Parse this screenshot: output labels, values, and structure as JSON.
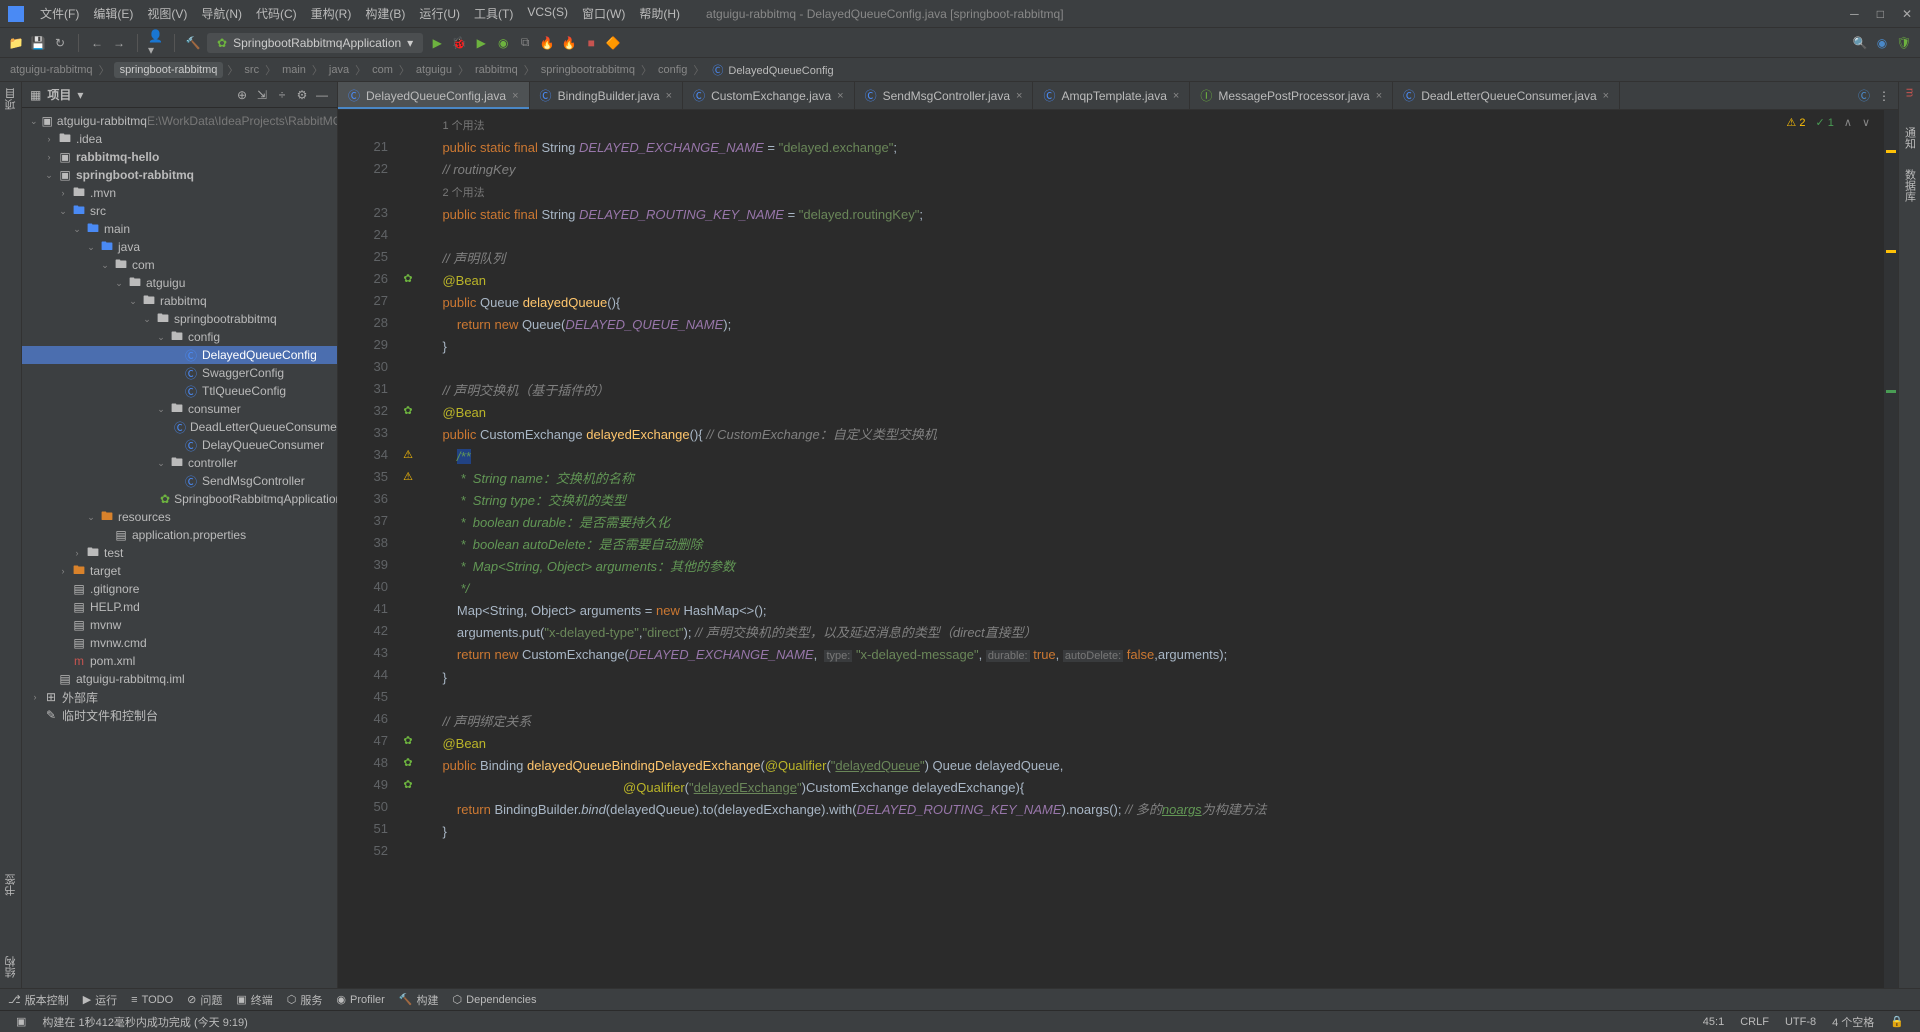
{
  "window": {
    "title": "atguigu-rabbitmq - DelayedQueueConfig.java [springboot-rabbitmq]"
  },
  "menu": {
    "file": "文件(F)",
    "edit": "编辑(E)",
    "view": "视图(V)",
    "navigate": "导航(N)",
    "code": "代码(C)",
    "refactor": "重构(R)",
    "build": "构建(B)",
    "run": "运行(U)",
    "tools": "工具(T)",
    "vcs": "VCS(S)",
    "window": "窗口(W)",
    "help": "帮助(H)"
  },
  "run_config": "SpringbootRabbitmqApplication",
  "breadcrumb": [
    "atguigu-rabbitmq",
    "springboot-rabbitmq",
    "src",
    "main",
    "java",
    "com",
    "atguigu",
    "rabbitmq",
    "springbootrabbitmq",
    "config",
    "DelayedQueueConfig"
  ],
  "project": {
    "title": "项目",
    "root": "atguigu-rabbitmq",
    "root_path": "E:\\WorkData\\IdeaProjects\\RabbitMQ\\at",
    "tree": [
      {
        "d": 0,
        "exp": true,
        "icon": "project",
        "label": "atguigu-rabbitmq",
        "suffix": "  E:\\WorkData\\IdeaProjects\\RabbitMQ\\at"
      },
      {
        "d": 1,
        "exp": false,
        "icon": "folder",
        "label": ".idea"
      },
      {
        "d": 1,
        "exp": false,
        "icon": "module",
        "label": "rabbitmq-hello",
        "bold": true
      },
      {
        "d": 1,
        "exp": true,
        "icon": "module",
        "label": "springboot-rabbitmq",
        "bold": true
      },
      {
        "d": 2,
        "exp": false,
        "icon": "folder",
        "label": ".mvn"
      },
      {
        "d": 2,
        "exp": true,
        "icon": "folder-blue",
        "label": "src"
      },
      {
        "d": 3,
        "exp": true,
        "icon": "folder-blue",
        "label": "main"
      },
      {
        "d": 4,
        "exp": true,
        "icon": "folder-blue",
        "label": "java"
      },
      {
        "d": 5,
        "exp": true,
        "icon": "folder",
        "label": "com"
      },
      {
        "d": 6,
        "exp": true,
        "icon": "folder",
        "label": "atguigu"
      },
      {
        "d": 7,
        "exp": true,
        "icon": "folder",
        "label": "rabbitmq"
      },
      {
        "d": 8,
        "exp": true,
        "icon": "folder",
        "label": "springbootrabbitmq"
      },
      {
        "d": 9,
        "exp": true,
        "icon": "folder",
        "label": "config"
      },
      {
        "d": 10,
        "icon": "class",
        "label": "DelayedQueueConfig",
        "selected": true
      },
      {
        "d": 10,
        "icon": "class",
        "label": "SwaggerConfig"
      },
      {
        "d": 10,
        "icon": "class",
        "label": "TtlQueueConfig"
      },
      {
        "d": 9,
        "exp": true,
        "icon": "folder",
        "label": "consumer"
      },
      {
        "d": 10,
        "icon": "class",
        "label": "DeadLetterQueueConsumer"
      },
      {
        "d": 10,
        "icon": "class",
        "label": "DelayQueueConsumer"
      },
      {
        "d": 9,
        "exp": true,
        "icon": "folder",
        "label": "controller"
      },
      {
        "d": 10,
        "icon": "class",
        "label": "SendMsgController"
      },
      {
        "d": 9,
        "icon": "spring",
        "label": "SpringbootRabbitmqApplication"
      },
      {
        "d": 4,
        "exp": true,
        "icon": "folder-res",
        "label": "resources"
      },
      {
        "d": 5,
        "icon": "props",
        "label": "application.properties"
      },
      {
        "d": 3,
        "exp": false,
        "icon": "folder",
        "label": "test"
      },
      {
        "d": 2,
        "exp": false,
        "icon": "folder-orange",
        "label": "target"
      },
      {
        "d": 2,
        "icon": "file",
        "label": ".gitignore"
      },
      {
        "d": 2,
        "icon": "md",
        "label": "HELP.md"
      },
      {
        "d": 2,
        "icon": "file",
        "label": "mvnw"
      },
      {
        "d": 2,
        "icon": "file",
        "label": "mvnw.cmd"
      },
      {
        "d": 2,
        "icon": "maven",
        "label": "pom.xml"
      },
      {
        "d": 1,
        "icon": "file",
        "label": "atguigu-rabbitmq.iml"
      },
      {
        "d": 0,
        "exp": false,
        "icon": "lib",
        "label": "外部库"
      },
      {
        "d": 0,
        "icon": "scratch",
        "label": "临时文件和控制台"
      }
    ]
  },
  "tabs": [
    {
      "icon": "class",
      "label": "DelayedQueueConfig.java",
      "active": true
    },
    {
      "icon": "class",
      "label": "BindingBuilder.java"
    },
    {
      "icon": "class",
      "label": "CustomExchange.java"
    },
    {
      "icon": "class",
      "label": "SendMsgController.java"
    },
    {
      "icon": "class",
      "label": "AmqpTemplate.java"
    },
    {
      "icon": "interface",
      "label": "MessagePostProcessor.java"
    },
    {
      "icon": "class",
      "label": "DeadLetterQueueConsumer.java"
    }
  ],
  "inspections": {
    "warnings": "2",
    "ok": "1"
  },
  "gutter_start": 21,
  "code_lines": [
    {
      "n": "",
      "t": "<span class='usage-hint'>1 个用法</span>"
    },
    {
      "n": 21,
      "t": "<span class='kw'>public static final</span> String <span class='const'>DELAYED_EXCHANGE_NAME</span> = <span class='str'>\"delayed.exchange\"</span>;"
    },
    {
      "n": 22,
      "t": "<span class='comment'>// routingKey</span>"
    },
    {
      "n": "",
      "t": "<span class='usage-hint'>2 个用法</span>"
    },
    {
      "n": 23,
      "t": "<span class='kw'>public static final</span> String <span class='const'>DELAYED_ROUTING_KEY_NAME</span> = <span class='str'>\"delayed.routingKey\"</span>;"
    },
    {
      "n": 24,
      "t": ""
    },
    {
      "n": 25,
      "t": "<span class='comment'>// 声明队列</span>"
    },
    {
      "n": 26,
      "g": "bean",
      "t": "<span class='anno'>@Bean</span>"
    },
    {
      "n": 27,
      "t": "<span class='kw'>public</span> Queue <span class='method'>delayedQueue</span>(){"
    },
    {
      "n": 28,
      "t": "    <span class='kw'>return new</span> Queue(<span class='const'>DELAYED_QUEUE_NAME</span>);"
    },
    {
      "n": 29,
      "t": "}"
    },
    {
      "n": 30,
      "t": ""
    },
    {
      "n": 31,
      "t": "<span class='comment'>// 声明交换机（基于插件的）</span>"
    },
    {
      "n": 32,
      "g": "bean",
      "t": "<span class='anno'>@Bean</span>"
    },
    {
      "n": 33,
      "t": "<span class='kw'>public</span> CustomExchange <span class='method'>delayedExchange</span>(){ <span class='comment'>// CustomExchange：自定义类型交换机</span>"
    },
    {
      "n": 34,
      "g": "warn",
      "t": "    <span class='doc hl'>/**</span>"
    },
    {
      "n": 35,
      "g": "warn",
      "t": "<span class='doc'>     *  String name：交换机的名称</span>"
    },
    {
      "n": 36,
      "t": "<span class='doc'>     *  String type：交换机的类型</span>"
    },
    {
      "n": 37,
      "t": "<span class='doc'>     *  boolean durable：是否需要持久化</span>"
    },
    {
      "n": 38,
      "t": "<span class='doc'>     *  boolean autoDelete：是否需要自动删除</span>"
    },
    {
      "n": 39,
      "t": "<span class='doc'>     *  Map&lt;String, Object&gt; arguments：其他的参数</span>"
    },
    {
      "n": 40,
      "t": "<span class='doc'>     */</span>"
    },
    {
      "n": 41,
      "t": "    Map&lt;String, Object&gt; arguments = <span class='kw'>new</span> HashMap&lt;&gt;();"
    },
    {
      "n": 42,
      "t": "    arguments.put(<span class='str'>\"x-delayed-type\"</span>,<span class='str'>\"direct\"</span>); <span class='comment'>// 声明交换机的类型，以及延迟消息的类型（direct直接型）</span>"
    },
    {
      "n": 43,
      "t": "    <span class='kw'>return new</span> CustomExchange(<span class='const'>DELAYED_EXCHANGE_NAME</span>,  <span class='param-hint'>type:</span> <span class='str'>\"x-delayed-message\"</span>, <span class='param-hint'>durable:</span> <span class='kw'>true</span>, <span class='param-hint'>autoDelete:</span> <span class='kw'>false</span>,arguments);"
    },
    {
      "n": 44,
      "t": "}"
    },
    {
      "n": 45,
      "t": ""
    },
    {
      "n": 46,
      "t": "<span class='comment'>// 声明绑定关系</span>"
    },
    {
      "n": 47,
      "g": "bean",
      "t": "<span class='anno'>@Bean</span>"
    },
    {
      "n": 48,
      "g": "bean",
      "t": "<span class='kw'>public</span> Binding <span class='method'>delayedQueueBindingDelayedExchange</span>(<span class='anno'>@Qualifier</span>(<span class='str'>\"<u>delayedQueue</u>\"</span>) Queue delayedQueue,"
    },
    {
      "n": 49,
      "g": "bean",
      "t": "                                                  <span class='anno'>@Qualifier</span>(<span class='str'>\"<u>delayedExchange</u>\"</span>)CustomExchange delayedExchange){"
    },
    {
      "n": 50,
      "t": "    <span class='kw'>return</span> BindingBuilder.<span style='font-style:italic'>bind</span>(delayedQueue).to(delayedExchange).with(<span class='const'>DELAYED_ROUTING_KEY_NAME</span>).noargs(); <span class='comment'>// 多的<u style='color:#629755'>noargs</u>为构建方法</span>"
    },
    {
      "n": 51,
      "t": "}"
    },
    {
      "n": 52,
      "t": ""
    }
  ],
  "bottombar": {
    "version_control": "版本控制",
    "run": "运行",
    "todo": "TODO",
    "problems": "问题",
    "terminal": "终端",
    "services": "服务",
    "profiler": "Profiler",
    "build": "构建",
    "dependencies": "Dependencies"
  },
  "statusbar": {
    "build_msg": "构建在 1秒412毫秒内成功完成 (今天 9:19)",
    "pos": "45:1",
    "line_sep": "CRLF",
    "encoding": "UTF-8",
    "indent": "4 个空格"
  },
  "leftbar": {
    "project": "项目",
    "structure": "结构",
    "bookmarks": "书签"
  },
  "rightbar": {
    "maven": "Maven",
    "database": "数据库",
    "notifications": "通知"
  }
}
